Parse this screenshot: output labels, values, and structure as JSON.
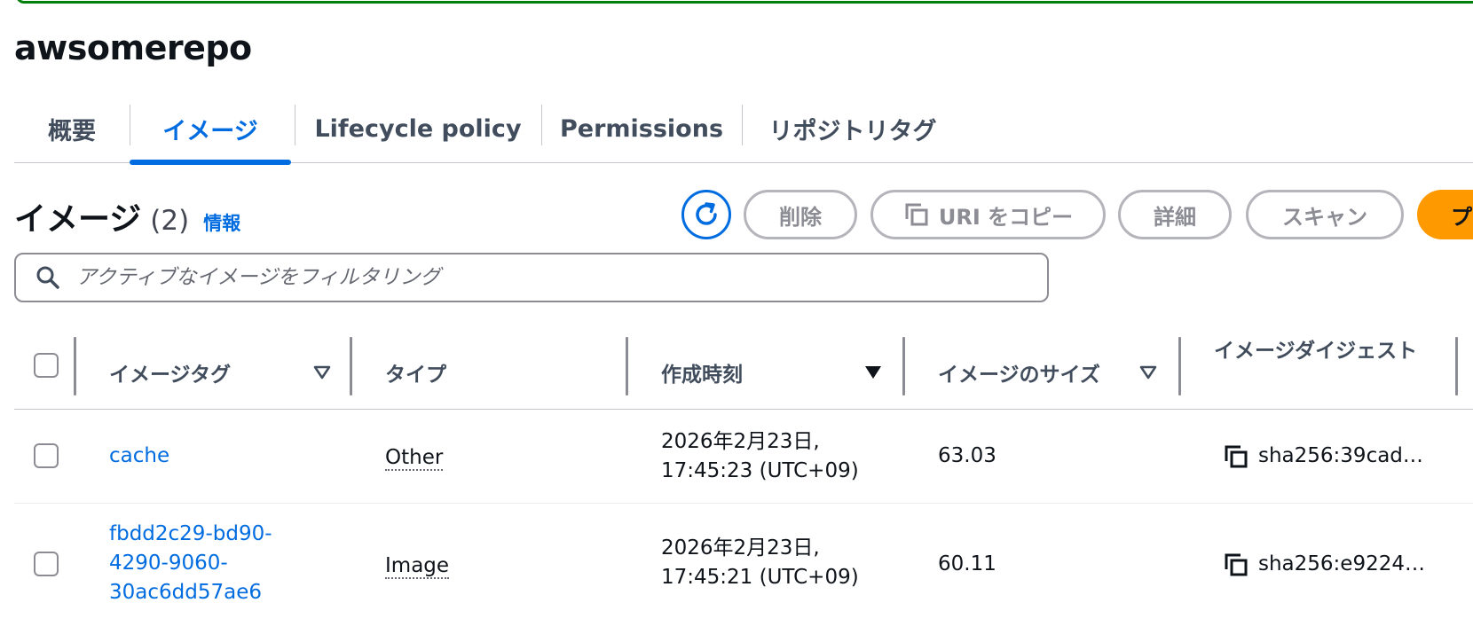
{
  "repository": {
    "name": "awsomerepo"
  },
  "tabs": [
    {
      "label": "概要"
    },
    {
      "label": "イメージ",
      "active": true
    },
    {
      "label": "Lifecycle policy"
    },
    {
      "label": "Permissions"
    },
    {
      "label": "リポジトリタグ"
    }
  ],
  "section": {
    "title": "イメージ",
    "count": "(2)",
    "info_link": "情報"
  },
  "actions": {
    "delete": "削除",
    "copy_uri": "URI をコピー",
    "details": "詳細",
    "scan": "スキャン",
    "push": "プ"
  },
  "search": {
    "placeholder": "アクティブなイメージをフィルタリング",
    "value": ""
  },
  "table": {
    "columns": [
      "イメージタグ",
      "タイプ",
      "作成時刻",
      "イメージのサイズ",
      "イメージダイジェスト"
    ],
    "rows": [
      {
        "tag_lines": [
          "cache"
        ],
        "type": "Other",
        "created_lines": [
          "2026年2月23日,",
          "17:45:23 (UTC+09)"
        ],
        "size": "63.03",
        "digest": "sha256:39cad…"
      },
      {
        "tag_lines": [
          "fbdd2c29-bd90-",
          "4290-9060-",
          "30ac6dd57ae6"
        ],
        "type": "Image",
        "created_lines": [
          "2026年2月23日,",
          "17:45:21 (UTC+09)"
        ],
        "size": "60.11",
        "digest": "sha256:e9224…"
      }
    ]
  },
  "colors": {
    "accent": "#006ce0",
    "primary_button": "#ff9900",
    "success_border": "#037f0c"
  }
}
